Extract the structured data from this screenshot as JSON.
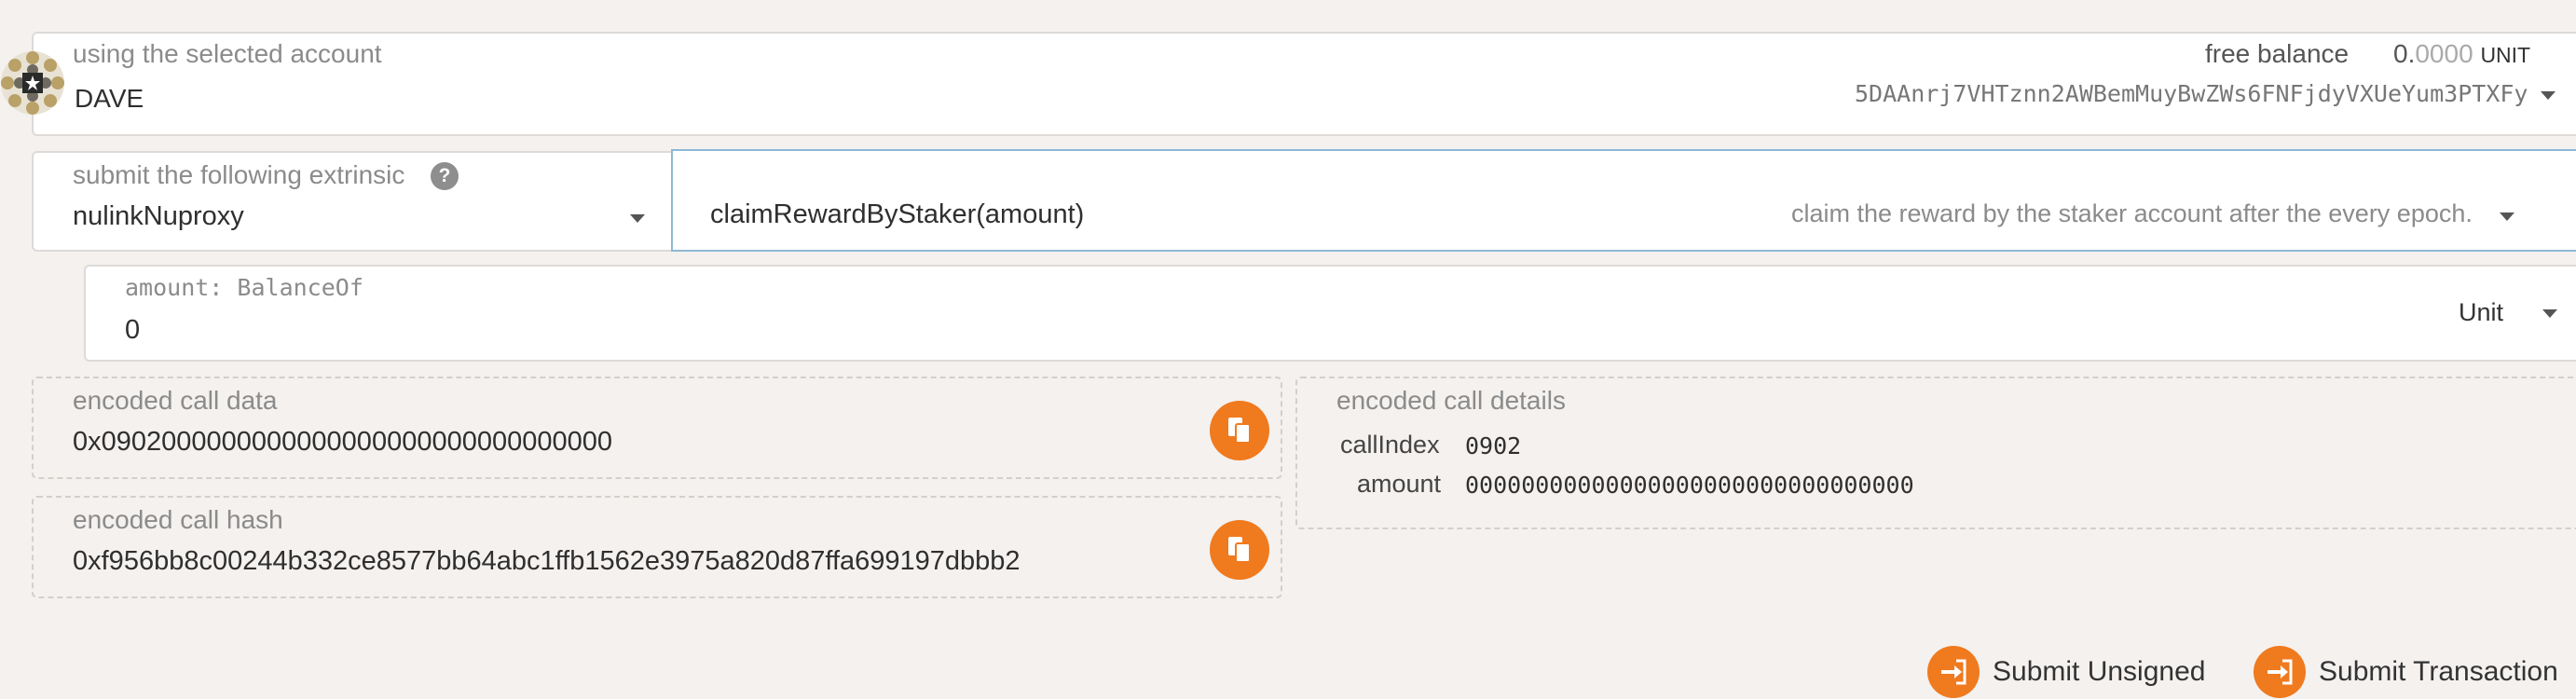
{
  "account": {
    "label": "using the selected account",
    "name": "DAVE",
    "free_balance_label": "free balance",
    "balance_int": "0.",
    "balance_frac": "0000",
    "balance_unit": "UNIT",
    "address": "5DAAnrj7VHTznn2AWBemMuyBwZWs6FNFjdyVXUeYum3PTXFy"
  },
  "extrinsic": {
    "label": "submit the following extrinsic",
    "help_glyph": "?",
    "module": "nulinkNuproxy",
    "method": "claimRewardByStaker(amount)",
    "method_description": "claim the reward by the staker account after the every epoch."
  },
  "param": {
    "label": "amount: BalanceOf",
    "value": "0",
    "unit": "Unit"
  },
  "call_data": {
    "label": "encoded call data",
    "value": "0x0902000000000000000000000000000000"
  },
  "call_hash": {
    "label": "encoded call hash",
    "value": "0xf956bb8c00244b332ce8577bb64abc1ffb1562e3975a820d87ffa699197dbbb2"
  },
  "call_details": {
    "label": "encoded call details",
    "rows": [
      {
        "key": "callIndex",
        "value": "0902"
      },
      {
        "key": "amount",
        "value": "00000000000000000000000000000000"
      }
    ]
  },
  "actions": {
    "submit_unsigned": "Submit Unsigned",
    "submit_transaction": "Submit Transaction"
  },
  "colors": {
    "accent": "#f07a1e",
    "background": "#f4f1ef",
    "input_focus": "#8fb8d6"
  },
  "icons": [
    "account-identicon",
    "help-icon",
    "chevron-down-icon",
    "copy-icon",
    "sign-in-icon"
  ]
}
